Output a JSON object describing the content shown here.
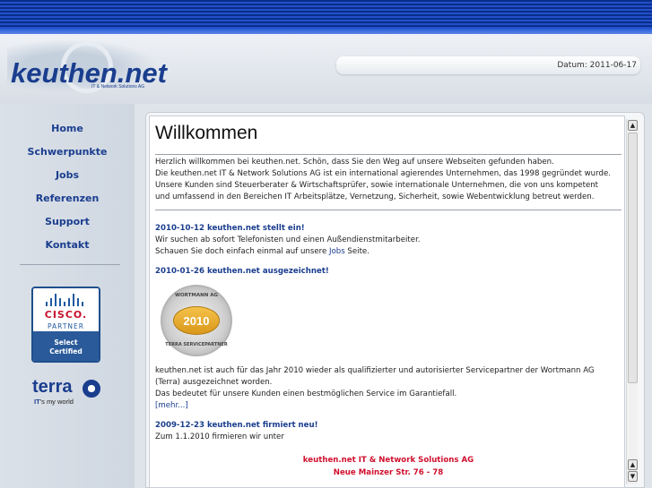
{
  "header": {
    "logo_text": "keuthen.net",
    "logo_sub": "IT & Network Solutions AG",
    "date_text": "Datum: 2011-06-17"
  },
  "sidebar": {
    "items": [
      {
        "label": "Home"
      },
      {
        "label": "Schwerpunkte"
      },
      {
        "label": "Jobs"
      },
      {
        "label": "Referenzen"
      },
      {
        "label": "Support"
      },
      {
        "label": "Kontakt"
      }
    ],
    "cisco": {
      "word": "CISCO.",
      "partner": "PARTNER",
      "line1": "Select",
      "line2": "Certified"
    },
    "terra": {
      "word": "terra",
      "sub_strong": "IT",
      "sub_rest": "'s my world"
    }
  },
  "main": {
    "title": "Willkommen",
    "intro": [
      "Herzlich willkommen bei keuthen.net. Schön, dass Sie den Weg auf unsere Webseiten gefunden haben.",
      "Die keuthen.net IT & Network Solutions AG ist ein international agierendes Unternehmen, das 1998 gegründet wurde.",
      "Unsere Kunden sind Steuerberater & Wirtschaftsprüfer, sowie internationale Unternehmen, die von uns kompetent",
      "und umfassend in den Bereichen IT Arbeitsplätze, Vernetzung, Sicherheit, sowie Webentwicklung betreut werden."
    ],
    "news": [
      {
        "headline": "2010-10-12 keuthen.net stellt ein!",
        "line1": "Wir suchen ab sofort Telefonisten und einen Außendienstmitarbeiter.",
        "line2_pre": "Schauen Sie doch einfach einmal auf unsere ",
        "line2_link": "Jobs",
        "line2_post": " Seite."
      },
      {
        "headline": "2010-01-26 keuthen.net ausgezeichnet!",
        "badge_top": "WORTMANN AG",
        "badge_year": "2010",
        "badge_bottom": "TERRA SERVICEPARTNER",
        "line1": "keuthen.net ist auch für das Jahr 2010 wieder als qualifizierter und autorisierter Servicepartner der Wortmann AG",
        "line2": "(Terra) ausgezeichnet worden.",
        "line3": "Das bedeutet für unsere Kunden einen bestmöglichen Service im Garantiefall.",
        "more": "[mehr...]"
      },
      {
        "headline": "2009-12-23 keuthen.net firmiert neu!",
        "line1": "Zum 1.1.2010 firmieren wir unter",
        "company": "keuthen.net IT & Network Solutions AG",
        "street": "Neue Mainzer Str. 76 - 78"
      }
    ]
  },
  "scrollbar": {
    "up": "▲",
    "down": "▼"
  }
}
